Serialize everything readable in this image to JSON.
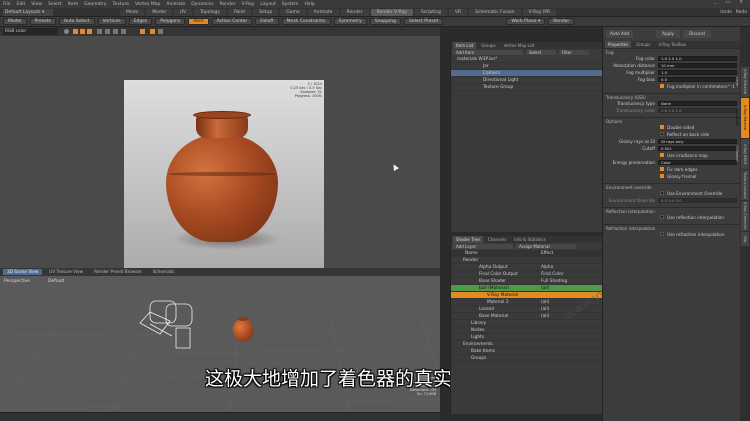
{
  "menubar": {
    "items": [
      "File",
      "Edit",
      "View",
      "Select",
      "Item",
      "Geometry",
      "Texture",
      "Vertex Map",
      "Animate",
      "Dynamics",
      "Render",
      "V-Ray",
      "Layout",
      "System",
      "Help"
    ],
    "right": "_ ☐ ✕"
  },
  "layout": {
    "name": "Default Layouts ▾",
    "tabs": [
      "Modo",
      "Model",
      "UV",
      "Topology",
      "Paint",
      "Setup",
      "Game",
      "Animate",
      "Render",
      "Render V-Ray",
      "Scripting",
      "VR",
      "Schematic Fusion",
      "V-Ray IPR"
    ],
    "right": [
      "Undo",
      "Redo"
    ]
  },
  "toolbar": {
    "items": [
      "Model",
      "Presets",
      "Auto Select",
      "Vertices",
      "Edges",
      "Polygons",
      "Item",
      "Action Center",
      "Falloff",
      "Mesh Constraints",
      "Symmetry",
      "Snapping",
      "Select Preset"
    ],
    "right": [
      "Work Plane ▾",
      "Render"
    ]
  },
  "viewport_top": {
    "shader_dropdown": "RGB color",
    "stats": [
      "3 / 1024",
      "0.25 Sec / 0.5 Sec",
      "Samples: 32",
      "Progress: 100%"
    ]
  },
  "viewport_tabs": {
    "items": [
      "3D Scene View",
      "UV Texture View",
      "Render Preset Browser",
      "Schematic"
    ],
    "active": 0
  },
  "viewport_3d": {
    "view": "Perspective",
    "shading": "Default",
    "stats": [
      "No Items",
      "Polygons: Face",
      "Channels: 0",
      "Deformers: ON",
      "GL: 71,808"
    ]
  },
  "subtitle": "这极大地增加了着色器的真实性",
  "watermark": "www.yyulaoshi.com",
  "item_list": {
    "tabs": [
      "Item List",
      "Groups",
      "Vertex Map List"
    ],
    "add_item": "Add Item",
    "filter": "Filter",
    "search": "Select",
    "rows": [
      {
        "label": "materials W3P.lxo*",
        "indent": 0,
        "selected": false
      },
      {
        "label": "Jar",
        "indent": 2,
        "selected": false
      },
      {
        "label": "Camera",
        "indent": 2,
        "selected": true
      },
      {
        "label": "Directional Light",
        "indent": 2,
        "selected": false
      },
      {
        "label": "Texture Group",
        "indent": 2,
        "selected": false
      }
    ]
  },
  "shader_tree": {
    "tabs": [
      "Shader Tree",
      "Channels",
      "Info & Statistics"
    ],
    "add_layer": "Add Layer",
    "assign": "Assign Material",
    "columns": [
      "Name",
      "Effect"
    ],
    "rows": [
      {
        "name": "Render",
        "effect": "",
        "style": "normal"
      },
      {
        "name": "Alpha Output",
        "effect": "Alpha",
        "style": "normal"
      },
      {
        "name": "Final Color Output",
        "effect": "Final Color",
        "style": "normal"
      },
      {
        "name": "Base Shader",
        "effect": "Full Shading",
        "style": "normal"
      },
      {
        "name": "ball (Material)",
        "effect": "(all)",
        "style": "green"
      },
      {
        "name": "V-Ray Material",
        "effect": "",
        "style": "orange"
      },
      {
        "name": "Material 2",
        "effect": "(all)",
        "style": "normal"
      },
      {
        "name": "Locked",
        "effect": "(all)",
        "style": "normal"
      },
      {
        "name": "Base Material",
        "effect": "(all)",
        "style": "normal"
      },
      {
        "name": "Library",
        "effect": "",
        "style": "normal"
      },
      {
        "name": "Nodes",
        "effect": "",
        "style": "normal"
      },
      {
        "name": "Lights",
        "effect": "",
        "style": "normal"
      },
      {
        "name": "Environments",
        "effect": "",
        "style": "normal"
      },
      {
        "name": "Bake Items",
        "effect": "",
        "style": "normal"
      },
      {
        "name": "Groups",
        "effect": "",
        "style": "normal"
      }
    ]
  },
  "properties": {
    "top_buttons": [
      "Auto Add",
      "Apply",
      "Discard"
    ],
    "tabs": [
      "Properties",
      "Groups",
      "V-Ray Toolbox"
    ],
    "fog_section": "Fog",
    "fields": [
      {
        "label": "Fog color",
        "value": "1.0    1.0    1.0"
      },
      {
        "label": "Absorption distance",
        "value": "10 mm"
      },
      {
        "label": "Fog multiplier",
        "value": "1.0"
      },
      {
        "label": "Fog bias",
        "value": "0.0"
      }
    ],
    "fog_units": "Fog multiplier in centimeters^-1",
    "translucency_section": "Translucency (SSS)",
    "translucency_type": {
      "label": "Translucency type",
      "value": "None"
    },
    "translucency_color": {
      "label": "Translucency color",
      "value": "1.0    1.0    1.0"
    },
    "options_section": "Options",
    "options": [
      "Double sided",
      "Reflect on back side"
    ],
    "glossy": {
      "label": "Glossy rays as GI",
      "value": "GI rays only"
    },
    "cutoff": {
      "label": "Cutoff",
      "value": "0.001"
    },
    "use_irradiance": "Use irradiance map",
    "energy": {
      "label": "Energy preservation",
      "value": "Color"
    },
    "fix_dark": "Fix dark edges",
    "glossy_fresnel": "Glossy fresnel",
    "env_section": "Environment override",
    "use_env": "Use Environment Override",
    "env_override": {
      "label": "Environment Override",
      "value": "0.0   0.0   0.0"
    },
    "refl_section": "Reflection interpolation",
    "use_refl": "Use reflection interpolation",
    "refr_section": "Refraction interpolation",
    "use_refr": "Use refraction interpolation"
  },
  "side_tabs": [
    "V-Ray Material Layer",
    "V-Ray Material Advanced",
    "V-Ray BRDF Common",
    "Texture Locator",
    "V-Ray Channels",
    "Mat"
  ],
  "colors": {
    "accent": "#e58a1f",
    "select": "#536b8c",
    "green": "#4f9a4a"
  }
}
